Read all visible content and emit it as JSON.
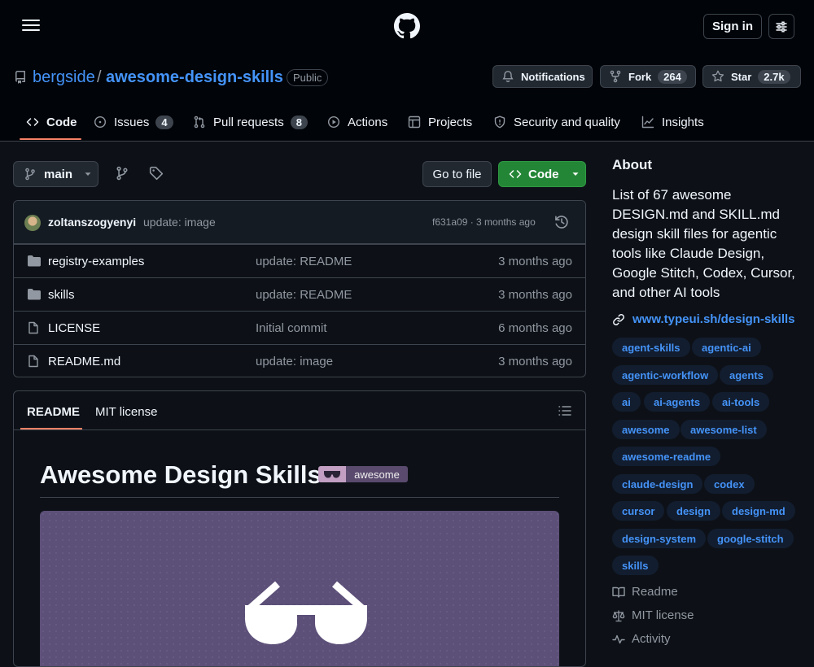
{
  "header": {
    "sign_in": "Sign in"
  },
  "repo": {
    "owner": "bergside",
    "separator": "/",
    "name": "awesome-design-skills",
    "visibility": "Public",
    "notifications_label": "Notifications",
    "fork_label": "Fork",
    "fork_count": "264",
    "star_label": "Star",
    "star_count": "2.7k"
  },
  "tabs": [
    {
      "label": "Code",
      "count": ""
    },
    {
      "label": "Issues",
      "count": "4"
    },
    {
      "label": "Pull requests",
      "count": "8"
    },
    {
      "label": "Actions",
      "count": ""
    },
    {
      "label": "Projects",
      "count": ""
    },
    {
      "label": "Security and quality",
      "count": ""
    },
    {
      "label": "Insights",
      "count": ""
    }
  ],
  "toolbar": {
    "branch": "main",
    "go_to_file": "Go to file",
    "code": "Code"
  },
  "commit": {
    "author": "zoltanszogyenyi",
    "message": "update: image",
    "meta": "f631a09 · 3 months ago"
  },
  "files": [
    {
      "name": "registry-examples",
      "message": "update: README",
      "date": "3 months ago",
      "type": "folder"
    },
    {
      "name": "skills",
      "message": "update: README",
      "date": "3 months ago",
      "type": "folder"
    },
    {
      "name": "LICENSE",
      "message": "Initial commit",
      "date": "6 months ago",
      "type": "file"
    },
    {
      "name": "README.md",
      "message": "update: image",
      "date": "3 months ago",
      "type": "file"
    }
  ],
  "readme": {
    "tab_readme": "README",
    "tab_license": "MIT license",
    "title": "Awesome Design Skills",
    "badge_text": "awesome"
  },
  "about": {
    "title": "About",
    "description": "List of 67 awesome DESIGN.md and SKILL.md design skill files for agentic tools like Claude Design, Google Stitch, Codex, Cursor, and other AI tools",
    "link": "www.typeui.sh/design-skills",
    "topics": [
      "agent-skills",
      "agentic-ai",
      "agentic-workflow",
      "agents",
      "ai",
      "ai-agents",
      "ai-tools",
      "awesome",
      "awesome-list",
      "awesome-readme",
      "claude-design",
      "codex",
      "cursor",
      "design",
      "design-md",
      "design-system",
      "google-stitch",
      "skills"
    ],
    "readme_link": "Readme",
    "license_link": "MIT license",
    "activity_link": "Activity"
  },
  "colors": {
    "accent": "#4493f8",
    "primary_button": "#238636",
    "tab_underline": "#f78166",
    "background": "#0d1117"
  }
}
